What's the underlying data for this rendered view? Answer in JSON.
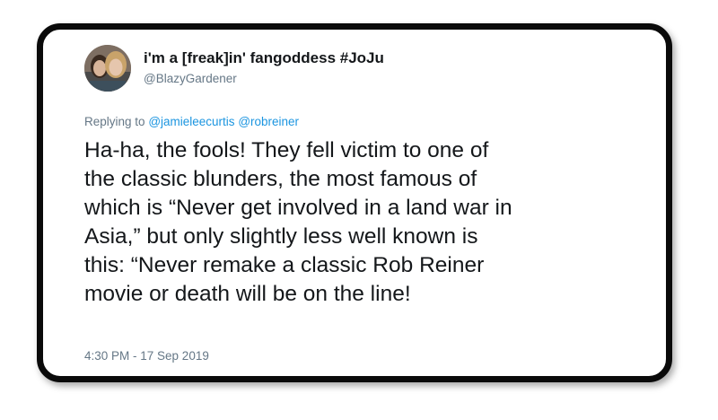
{
  "tweet": {
    "display_name": "i'm a [freak]in' fangoddess #JoJu",
    "handle": "@BlazyGardener",
    "replying_to_label": "Replying to",
    "replying_to_mentions": [
      "@jamieleecurtis",
      "@robreiner"
    ],
    "text_lines": [
      "Ha-ha, the fools! They fell victim to one of",
      "the classic blunders, the most famous of",
      "which is “Never get involved in a land war in",
      "Asia,” but only slightly less well known is",
      "this: “Never remake a classic Rob Reiner",
      "movie or death will be on the line!"
    ],
    "timestamp": "4:30 PM - 17 Sep 2019"
  },
  "colors": {
    "text_primary": "#14171a",
    "text_secondary": "#657786",
    "mention_link": "#1b95e0",
    "card_border": "#0a0a0a"
  }
}
